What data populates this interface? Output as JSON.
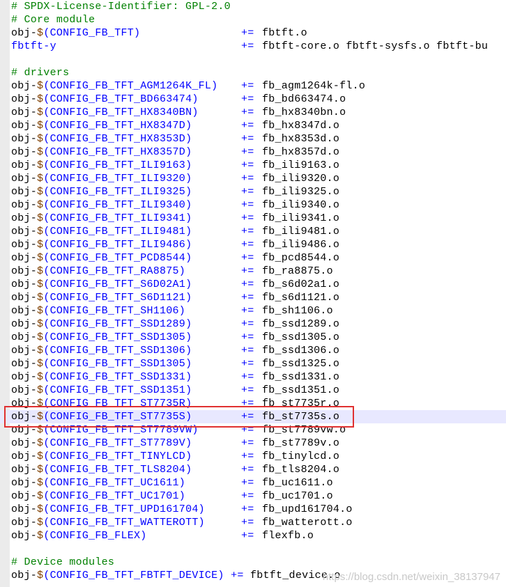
{
  "header": [
    {
      "type": "comment",
      "text": "# SPDX-License-Identifier: GPL-2.0"
    },
    {
      "type": "comment",
      "text": "# Core module"
    },
    {
      "type": "rule",
      "prefix": "obj-",
      "dollar": "$",
      "config": "(CONFIG_FB_TFT)",
      "op": "+=",
      "obj": "fbtft.o"
    },
    {
      "type": "rule",
      "prefix": "",
      "var": "fbtft-y",
      "op": "+=",
      "obj": "fbtft-core.o fbtft-sysfs.o fbtft-bu"
    },
    {
      "type": "blank",
      "text": ""
    },
    {
      "type": "comment",
      "text": "# drivers"
    }
  ],
  "drivers": [
    {
      "config": "(CONFIG_FB_TFT_AGM1264K_FL)",
      "obj": "fb_agm1264k-fl.o"
    },
    {
      "config": "(CONFIG_FB_TFT_BD663474)",
      "obj": "fb_bd663474.o"
    },
    {
      "config": "(CONFIG_FB_TFT_HX8340BN)",
      "obj": "fb_hx8340bn.o"
    },
    {
      "config": "(CONFIG_FB_TFT_HX8347D)",
      "obj": "fb_hx8347d.o"
    },
    {
      "config": "(CONFIG_FB_TFT_HX8353D)",
      "obj": "fb_hx8353d.o"
    },
    {
      "config": "(CONFIG_FB_TFT_HX8357D)",
      "obj": "fb_hx8357d.o"
    },
    {
      "config": "(CONFIG_FB_TFT_ILI9163)",
      "obj": "fb_ili9163.o"
    },
    {
      "config": "(CONFIG_FB_TFT_ILI9320)",
      "obj": "fb_ili9320.o"
    },
    {
      "config": "(CONFIG_FB_TFT_ILI9325)",
      "obj": "fb_ili9325.o"
    },
    {
      "config": "(CONFIG_FB_TFT_ILI9340)",
      "obj": "fb_ili9340.o"
    },
    {
      "config": "(CONFIG_FB_TFT_ILI9341)",
      "obj": "fb_ili9341.o"
    },
    {
      "config": "(CONFIG_FB_TFT_ILI9481)",
      "obj": "fb_ili9481.o"
    },
    {
      "config": "(CONFIG_FB_TFT_ILI9486)",
      "obj": "fb_ili9486.o"
    },
    {
      "config": "(CONFIG_FB_TFT_PCD8544)",
      "obj": "fb_pcd8544.o"
    },
    {
      "config": "(CONFIG_FB_TFT_RA8875)",
      "obj": "fb_ra8875.o"
    },
    {
      "config": "(CONFIG_FB_TFT_S6D02A1)",
      "obj": "fb_s6d02a1.o"
    },
    {
      "config": "(CONFIG_FB_TFT_S6D1121)",
      "obj": "fb_s6d1121.o"
    },
    {
      "config": "(CONFIG_FB_TFT_SH1106)",
      "obj": "fb_sh1106.o"
    },
    {
      "config": "(CONFIG_FB_TFT_SSD1289)",
      "obj": "fb_ssd1289.o"
    },
    {
      "config": "(CONFIG_FB_TFT_SSD1305)",
      "obj": "fb_ssd1305.o"
    },
    {
      "config": "(CONFIG_FB_TFT_SSD1306)",
      "obj": "fb_ssd1306.o"
    },
    {
      "config": "(CONFIG_FB_TFT_SSD1305)",
      "obj": "fb_ssd1325.o"
    },
    {
      "config": "(CONFIG_FB_TFT_SSD1331)",
      "obj": "fb_ssd1331.o"
    },
    {
      "config": "(CONFIG_FB_TFT_SSD1351)",
      "obj": "fb_ssd1351.o"
    },
    {
      "config": "(CONFIG_FB_TFT_ST7735R)",
      "obj": "fb_st7735r.o"
    },
    {
      "config": "(CONFIG_FB_TFT_ST7735S)",
      "obj": "fb_st7735s.o",
      "current": true
    },
    {
      "config": "(CONFIG_FB_TFT_ST7789VW)",
      "obj": "fb_st7789vw.o"
    },
    {
      "config": "(CONFIG_FB_TFT_ST7789V)",
      "obj": "fb_st7789v.o"
    },
    {
      "config": "(CONFIG_FB_TFT_TINYLCD)",
      "obj": "fb_tinylcd.o"
    },
    {
      "config": "(CONFIG_FB_TFT_TLS8204)",
      "obj": "fb_tls8204.o"
    },
    {
      "config": "(CONFIG_FB_TFT_UC1611)",
      "obj": "fb_uc1611.o"
    },
    {
      "config": "(CONFIG_FB_TFT_UC1701)",
      "obj": "fb_uc1701.o"
    },
    {
      "config": "(CONFIG_FB_TFT_UPD161704)",
      "obj": "fb_upd161704.o"
    },
    {
      "config": "(CONFIG_FB_TFT_WATTEROTT)",
      "obj": "fb_watterott.o"
    },
    {
      "config": "(CONFIG_FB_FLEX)",
      "obj": "flexfb.o"
    }
  ],
  "footer": [
    {
      "type": "blank",
      "text": ""
    },
    {
      "type": "comment",
      "text": "# Device modules"
    },
    {
      "type": "rule",
      "prefix": "obj-",
      "dollar": "$",
      "config": "(CONFIG_FB_TFT_FBTFT_DEVICE)",
      "op": "+=",
      "obj": "fbtft_device.o",
      "tight": true
    }
  ],
  "common": {
    "prefix": "obj-",
    "dollar": "$",
    "op": "+="
  },
  "watermark": "https://blog.csdn.net/weixin_38137947",
  "colors": {
    "comment": "#008000",
    "config": "#0000ff",
    "dollar": "#804000",
    "current_line": "#e8e8ff",
    "highlight_box": "#e03030"
  }
}
